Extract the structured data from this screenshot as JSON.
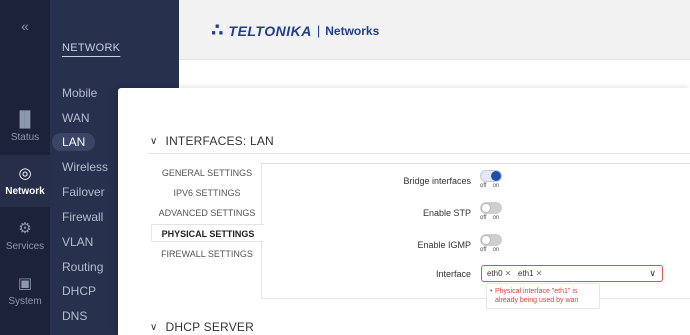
{
  "rail": {
    "collapse": "«",
    "items": [
      {
        "label": "Status",
        "icon": "signal-bars-icon"
      },
      {
        "label": "Network",
        "icon": "globe-icon"
      },
      {
        "label": "Services",
        "icon": "gear-icon"
      },
      {
        "label": "System",
        "icon": "device-icon"
      }
    ]
  },
  "subnav": {
    "title": "NETWORK",
    "items": [
      "Mobile",
      "WAN",
      "LAN",
      "Wireless",
      "Failover",
      "Firewall",
      "VLAN",
      "Routing",
      "DHCP",
      "DNS"
    ],
    "active": "LAN"
  },
  "header": {
    "brand": "TELTONIKA",
    "separator": "|",
    "sub": "Networks"
  },
  "sections": {
    "lan_title": "INTERFACES: LAN",
    "dhcp_title": "DHCP SERVER"
  },
  "tabs": [
    "GENERAL SETTINGS",
    "IPV6 SETTINGS",
    "ADVANCED SETTINGS",
    "PHYSICAL SETTINGS",
    "FIREWALL SETTINGS"
  ],
  "active_tab": "PHYSICAL SETTINGS",
  "form": {
    "bridge": {
      "label": "Bridge interfaces",
      "state": "on"
    },
    "stp": {
      "label": "Enable STP",
      "state": "off"
    },
    "igmp": {
      "label": "Enable IGMP",
      "state": "off"
    },
    "off_label": "off",
    "on_label": "on",
    "interface": {
      "label": "Interface",
      "chips": [
        "eth0",
        "eth1"
      ],
      "error": "Physical interface \"eth1\" is already being used by wan"
    }
  },
  "colors": {
    "rail_bg": "#1c2338",
    "subnav_bg": "#27304c",
    "accent": "#1f4fa8",
    "error": "#d9534f"
  }
}
